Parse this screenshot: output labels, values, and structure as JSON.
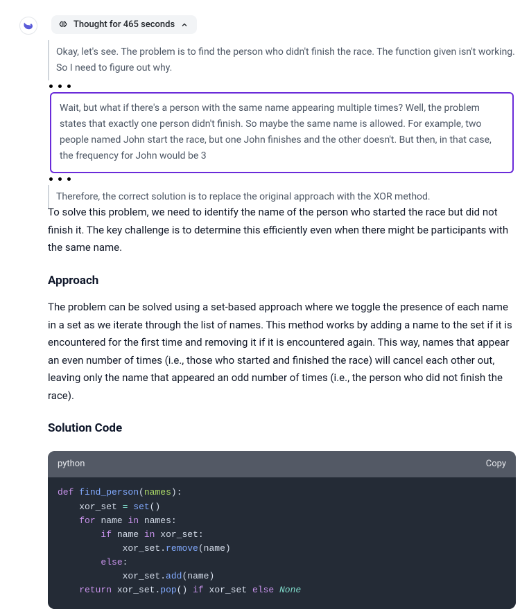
{
  "avatar": {
    "name": "assistant-logo"
  },
  "thought": {
    "label": "Thought for 465 seconds"
  },
  "reasoning": {
    "intro": "Okay, let's see. The problem is to find the person who didn't finish the race. The function given isn't working. So I need to figure out why.",
    "highlight": "Wait, but what if there's a person with the same name appearing multiple times? Well, the problem states that exactly one person didn't finish. So maybe the same name is allowed. For example, two people named John start the race, but one John finishes and the other doesn't. But then, in that case, the frequency for John would be 3",
    "conclusion": "Therefore, the correct solution is to replace the original approach with the XOR method."
  },
  "answer": {
    "intro": "To solve this problem, we need to identify the name of the person who started the race but did not finish it. The key challenge is to determine this efficiently even when there might be participants with the same name.",
    "approach_heading": "Approach",
    "approach_body": "The problem can be solved using a set-based approach where we toggle the presence of each name in a set as we iterate through the list of names. This method works by adding a name to the set if it is encountered for the first time and removing it if it is encountered again. This way, names that appear an even number of times (i.e., those who started and finished the race) will cancel each other out, leaving only the name that appeared an odd number of times (i.e., the person who did not finish the race).",
    "solution_heading": "Solution Code"
  },
  "code": {
    "language": "python",
    "copy_label": "Copy",
    "tokens": {
      "def": "def",
      "find_person": "find_person",
      "names": "names",
      "xor_set": "xor_set",
      "set": "set",
      "for": "for",
      "name": "name",
      "in": "in",
      "if": "if",
      "remove": "remove",
      "else": "else",
      "add": "add",
      "return": "return",
      "pop": "pop",
      "None": "None"
    }
  },
  "colors": {
    "highlight_border": "#6a2bd9",
    "code_bg": "#242b36",
    "code_head_bg": "#535965"
  }
}
